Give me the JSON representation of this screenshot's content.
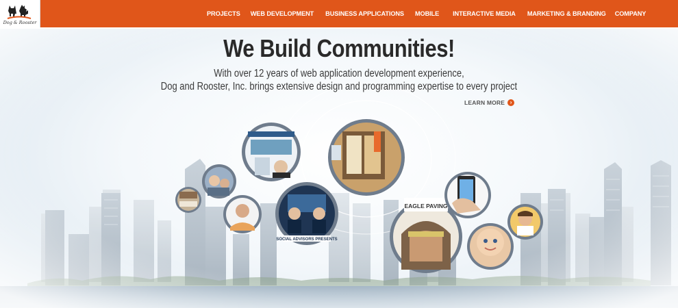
{
  "brand": {
    "logo_text": "Dog & Rooster"
  },
  "nav": {
    "items": [
      {
        "label": "Projects"
      },
      {
        "label": "Web Development"
      },
      {
        "label": "Business Applications"
      },
      {
        "label": "Mobile"
      },
      {
        "label": "Interactive Media"
      },
      {
        "label": "Marketing & Branding"
      },
      {
        "label": "Company"
      }
    ]
  },
  "hero": {
    "title": "We Build Communities!",
    "subtitle_line1": "With over 12 years of web application development experience,",
    "subtitle_line2": "Dog and Rooster, Inc. brings extensive design and programming expertise to every project",
    "learn_more": "LEARN MORE",
    "bubbles": [
      {
        "name": "web-project-bubble",
        "text": ""
      },
      {
        "name": "couple-photo-bubble",
        "text": ""
      },
      {
        "name": "medical-site-bubble",
        "text": ""
      },
      {
        "name": "blogger-photo-bubble",
        "text": ""
      },
      {
        "name": "financial-advisors-bubble",
        "text": "SOCIAL ADVISORS PRESENTS"
      },
      {
        "name": "office-interior-bubble",
        "text": ""
      },
      {
        "name": "eagle-paving-bubble",
        "text": "EAGLE PAVING"
      },
      {
        "name": "mobile-phone-bubble",
        "text": ""
      },
      {
        "name": "baby-photo-bubble",
        "text": ""
      },
      {
        "name": "kid-photo-bubble",
        "text": ""
      }
    ]
  },
  "colors": {
    "header": "#e0561a",
    "accent": "#e0561a",
    "text": "#2a2a2a"
  }
}
